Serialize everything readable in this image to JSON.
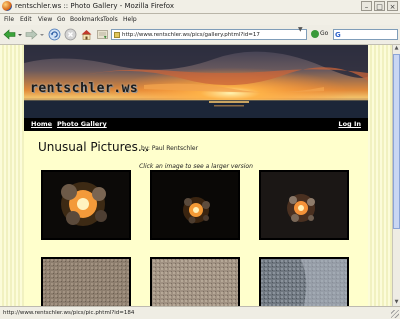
{
  "window": {
    "title": "rentschler.ws :: Photo Gallery - Mozilla Firefox"
  },
  "menu": [
    "File",
    "Edit",
    "View",
    "Go",
    "Bookmarks",
    "Tools",
    "Help"
  ],
  "toolbar": {
    "address": "http://www.rentschler.ws/pics/gallery.phtml?id=17",
    "go_label": "Go",
    "search_logo": "G"
  },
  "site": {
    "title": "rentschler.ws",
    "nav": {
      "home": "Home",
      "gallery": "Photo Gallery",
      "login": "Log In"
    }
  },
  "gallery": {
    "title": "Unusual Pictures...",
    "byline": "by: Paul Rentschler",
    "hint": "Click an image to see a larger version"
  },
  "status": {
    "text": "http://www.rentschler.ws/pics/pic.phtml?id=184"
  },
  "icons": [
    "firefox-icon",
    "minimize-icon",
    "maximize-icon",
    "close-icon",
    "back-arrow-icon",
    "forward-arrow-icon",
    "reload-icon",
    "stop-icon",
    "home-icon",
    "bookmark-icon",
    "page-icon",
    "go-icon",
    "google-icon"
  ],
  "colors": {
    "page_bg": "#ffffcc",
    "nav_bg": "#000000",
    "accent_sky": "#e8892b"
  }
}
